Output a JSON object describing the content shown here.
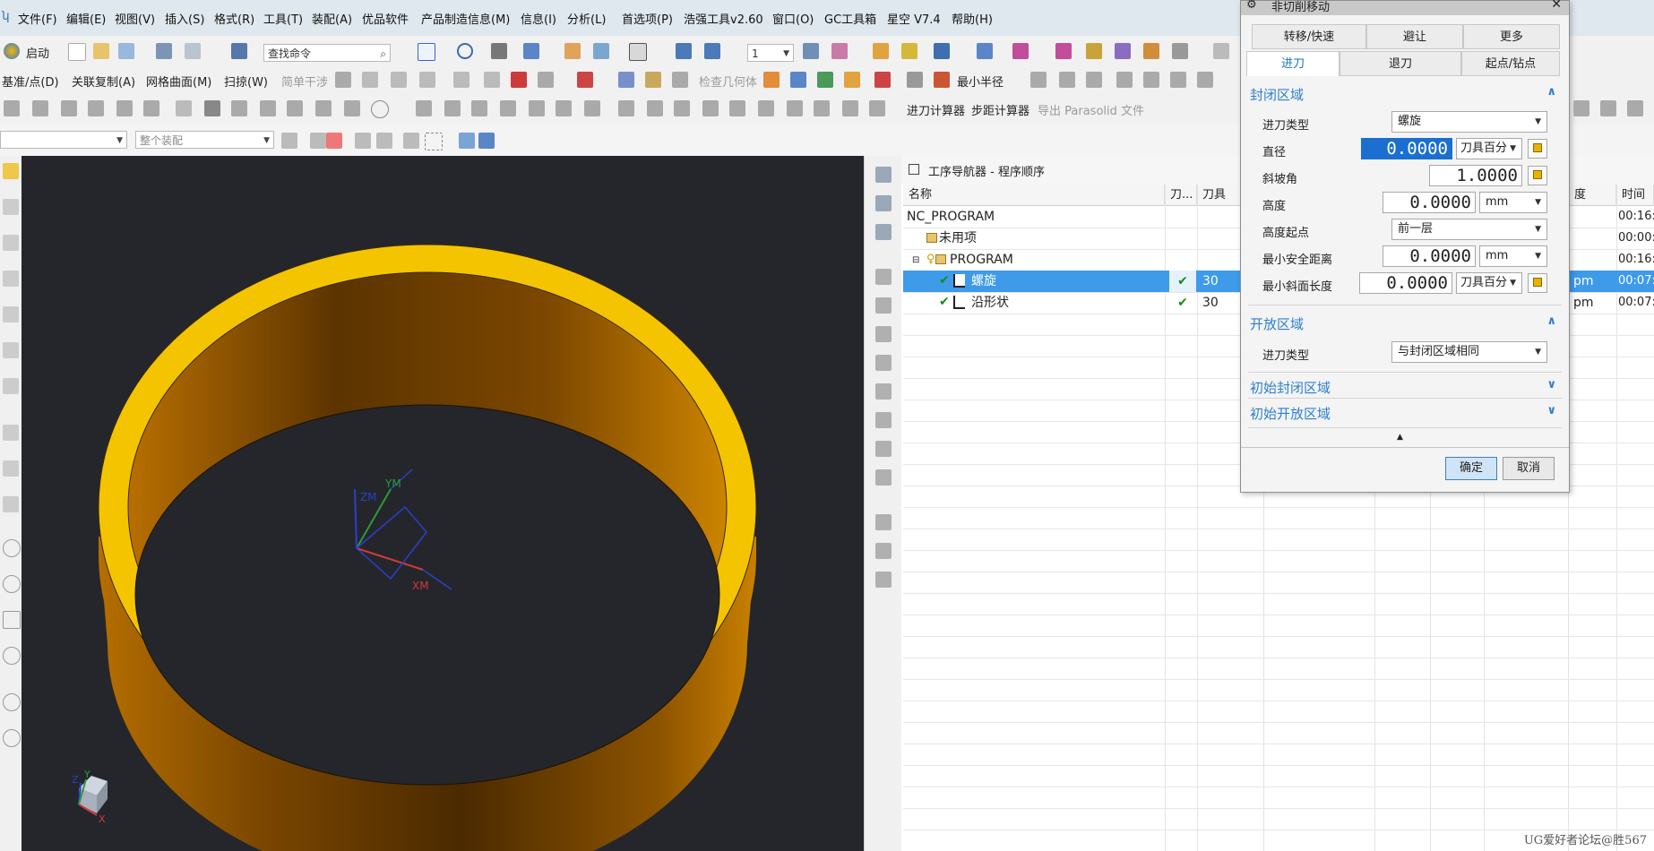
{
  "menu": {
    "items": [
      "文件(F)",
      "编辑(E)",
      "视图(V)",
      "插入(S)",
      "格式(R)",
      "工具(T)",
      "装配(A)",
      "优品软件",
      "产品制造信息(M)",
      "信息(I)",
      "分析(L)",
      "首选项(P)",
      "浩强工具v2.60",
      "窗口(O)",
      "GC工具箱",
      "星空 V7.4",
      "帮助(H)"
    ]
  },
  "toolbar1": {
    "start_label": "启动",
    "search_placeholder": "查找命令",
    "layer_value": "1"
  },
  "toolbar2": {
    "items": [
      "基准/点(D)",
      "关联复制(A)",
      "网格曲面(M)",
      "扫掠(W)",
      "简单干涉",
      "检查几何体",
      "最小半径"
    ]
  },
  "toolbar3": {
    "items": [
      "进刀计算器",
      "步距计算器",
      "导出 Parasolid 文件"
    ]
  },
  "toolbar4": {
    "filter_value": "",
    "assembly_value": "整个装配"
  },
  "viewport": {
    "axis_labels": {
      "zm": "ZM",
      "ym": "YM",
      "xm": "XM"
    },
    "triad_labels": {
      "x": "X",
      "y": "Y",
      "z": "Z"
    },
    "colors": {
      "ring_top": "#f5c400",
      "ring_side_light": "#c77a00",
      "ring_side_dark": "#5a3300",
      "background": "#24262b"
    }
  },
  "navigator": {
    "title": "工序导航器 - 程序顺序",
    "columns": [
      "名称",
      "刀...",
      "刀具",
      "度",
      "时间"
    ],
    "rows": [
      {
        "name": "NC_PROGRAM",
        "check": "",
        "tool": "",
        "speed": "",
        "time": "00:16:"
      },
      {
        "name": "未用项",
        "check": "",
        "tool": "",
        "speed": "",
        "time": "00:00:"
      },
      {
        "name": "PROGRAM",
        "check": "",
        "tool": "",
        "speed": "",
        "time": "00:16:"
      },
      {
        "name": "螺旋",
        "check": "✔",
        "tool": "30",
        "speed": "pm",
        "time": "00:07:"
      },
      {
        "name": "沿形状",
        "check": "✔",
        "tool": "30",
        "speed": "pm",
        "time": "00:07:"
      }
    ]
  },
  "dialog": {
    "title": "非切削移动",
    "tabs_row1": [
      "转移/快速",
      "避让",
      "更多"
    ],
    "tabs_row2": [
      "进刀",
      "退刀",
      "起点/钻点"
    ],
    "closed_area": {
      "header": "封闭区域",
      "engage_type_label": "进刀类型",
      "engage_type_value": "螺旋",
      "diameter_label": "直径",
      "diameter_value": "0.0000",
      "diameter_unit": "刀具百分",
      "ramp_angle_label": "斜坡角",
      "ramp_angle_value": "1.0000",
      "height_label": "高度",
      "height_value": "0.0000",
      "height_unit": "mm",
      "height_from_label": "高度起点",
      "height_from_value": "前一层",
      "min_safe_label": "最小安全距离",
      "min_safe_value": "0.0000",
      "min_safe_unit": "mm",
      "min_ramp_label": "最小斜面长度",
      "min_ramp_value": "0.0000",
      "min_ramp_unit": "刀具百分"
    },
    "open_area": {
      "header": "开放区域",
      "engage_type_label": "进刀类型",
      "engage_type_value": "与封闭区域相同"
    },
    "initial_closed": "初始封闭区域",
    "initial_open": "初始开放区域",
    "ok_label": "确定",
    "cancel_label": "取消"
  },
  "watermark": "UG爱好者论坛@胜567"
}
